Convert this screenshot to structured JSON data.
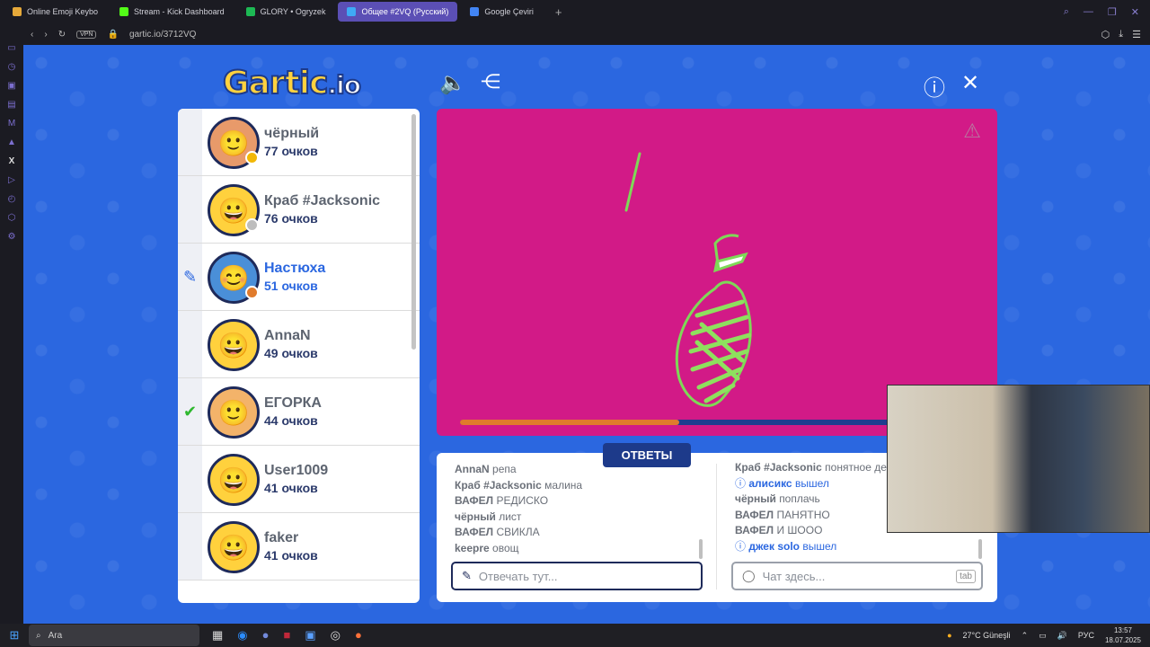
{
  "browser": {
    "tabs": [
      {
        "label": "Online Emoji Keybo",
        "color": "#e6a93a"
      },
      {
        "label": "Stream - Kick Dashboard",
        "color": "#53fc18"
      },
      {
        "label": "GLORY • Ogryzek",
        "color": "#1db954"
      },
      {
        "label": "Общее #2VQ (Русский)",
        "color": "#3fa9f5"
      },
      {
        "label": "Google Çeviri",
        "color": "#4285f4"
      }
    ],
    "url": "gartic.io/3712VQ",
    "vpn": "VPN"
  },
  "game": {
    "logo_main": "Gartic",
    "logo_tail": ".io",
    "players": [
      {
        "name": "чёрный",
        "score": "77 очков",
        "dot": "#f2b807",
        "face": "🙂",
        "status": "",
        "bg": "#e89a6a"
      },
      {
        "name": "Краб #Jacksonic",
        "score": "76 очков",
        "dot": "#bdbdbd",
        "face": "😀",
        "status": "",
        "bg": "#ffd13d"
      },
      {
        "name": "Настюха",
        "score": "51 очков",
        "dot": "#e07b2c",
        "face": "😊",
        "status": "✎",
        "bg": "#4a8fd8"
      },
      {
        "name": "AnnaN",
        "score": "49 очков",
        "dot": "",
        "face": "😀",
        "status": "",
        "bg": "#ffd13d"
      },
      {
        "name": "ЕГОРКА",
        "score": "44 очков",
        "dot": "",
        "face": "🙂",
        "status": "✔",
        "bg": "#f3b36a"
      },
      {
        "name": "User1009",
        "score": "41 очков",
        "dot": "",
        "face": "😀",
        "status": "",
        "bg": "#ffd13d"
      },
      {
        "name": "faker",
        "score": "41 очков",
        "dot": "",
        "face": "😀",
        "status": "",
        "bg": "#ffd13d"
      }
    ],
    "timer_progress": 0.42,
    "answers_tab": "ОТВЕТЫ",
    "answers": [
      {
        "who": "AnnaN",
        "text": "репа"
      },
      {
        "who": "Краб #Jacksonic",
        "text": "малина"
      },
      {
        "who": "ВАФЕЛ",
        "text": "РЕДИСКО"
      },
      {
        "who": "чёрный",
        "text": "лист"
      },
      {
        "who": "ВАФЕЛ",
        "text": "СВИКЛА"
      },
      {
        "who": "keepre",
        "text": "овощ"
      }
    ],
    "chat": [
      {
        "who": "Краб #Jacksonic",
        "text": "понятное де",
        "sys": false
      },
      {
        "who": "алисикс",
        "text": "вышел",
        "sys": true
      },
      {
        "who": "чёрный",
        "text": "поплачь",
        "sys": false
      },
      {
        "who": "ВАФЕЛ",
        "text": "ПАНЯТНО",
        "sys": false
      },
      {
        "who": "ВАФЕЛ",
        "text": "И ШООО",
        "sys": false
      },
      {
        "who": "джек solo",
        "text": "вышел",
        "sys": true
      }
    ],
    "answer_placeholder": "Отвечать тут...",
    "chat_placeholder": "Чат здесь...",
    "chat_hint": "tab"
  },
  "taskbar": {
    "search": "Ara",
    "weather": "27°C Güneşli",
    "lang": "РУС",
    "time": "13:57",
    "date": "18.07.2025"
  }
}
